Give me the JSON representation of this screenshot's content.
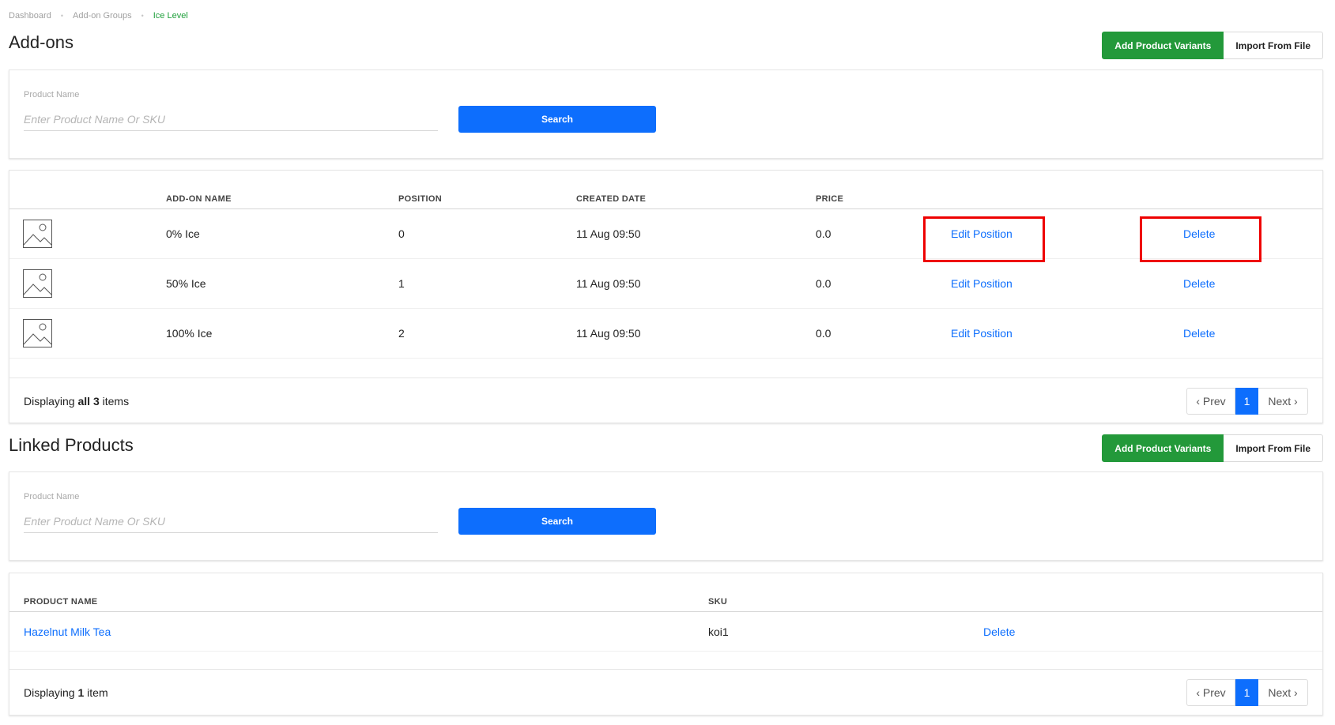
{
  "breadcrumb": {
    "items": [
      "Dashboard",
      "Add-on Groups"
    ],
    "current": "Ice Level",
    "separator": "•"
  },
  "addons": {
    "title": "Add-ons",
    "add_variants_label": "Add Product Variants",
    "import_label": "Import From File",
    "search": {
      "label": "Product Name",
      "placeholder": "Enter Product Name Or SKU",
      "value": "",
      "button_label": "Search"
    },
    "columns": [
      "ADD-ON NAME",
      "POSITION",
      "CREATED DATE",
      "PRICE"
    ],
    "rows": [
      {
        "name": "0% Ice",
        "position": "0",
        "created": "11 Aug 09:50",
        "price": "0.0",
        "edit_label": "Edit Position",
        "delete_label": "Delete"
      },
      {
        "name": "50% Ice",
        "position": "1",
        "created": "11 Aug 09:50",
        "price": "0.0",
        "edit_label": "Edit Position",
        "delete_label": "Delete"
      },
      {
        "name": "100% Ice",
        "position": "2",
        "created": "11 Aug 09:50",
        "price": "0.0",
        "edit_label": "Edit Position",
        "delete_label": "Delete"
      }
    ],
    "footer": {
      "prefix": "Displaying ",
      "bold": "all 3",
      "suffix": " items"
    },
    "pager": {
      "prev": "‹ Prev",
      "page": "1",
      "next": "Next ›"
    }
  },
  "linked": {
    "title": "Linked Products",
    "add_variants_label": "Add Product Variants",
    "import_label": "Import From File",
    "search": {
      "label": "Product Name",
      "placeholder": "Enter Product Name Or SKU",
      "value": "",
      "button_label": "Search"
    },
    "columns": [
      "PRODUCT NAME",
      "SKU"
    ],
    "rows": [
      {
        "name": "Hazelnut Milk Tea",
        "sku": "koi1",
        "delete_label": "Delete"
      }
    ],
    "footer": {
      "prefix": "Displaying ",
      "bold": "1",
      "suffix": " item"
    },
    "pager": {
      "prev": "‹ Prev",
      "page": "1",
      "next": "Next ›"
    }
  },
  "colors": {
    "primary": "#0d6efd",
    "success": "#23993a",
    "highlight": "#ee0000",
    "breadcrumb_current": "#1e9f3a"
  },
  "icons": {
    "row_image": "image-placeholder-icon"
  }
}
